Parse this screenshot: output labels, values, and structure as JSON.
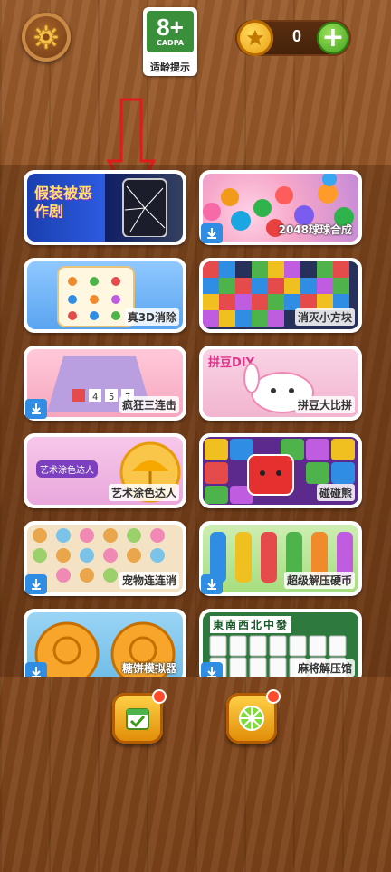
{
  "header": {
    "rating": {
      "age": "8+",
      "org": "CADPA",
      "hint": "适龄提示"
    },
    "coins": {
      "count": "0"
    }
  },
  "games": [
    {
      "label": "",
      "thumb_text": "假装被恶作剧",
      "download": false
    },
    {
      "label": "2048球球合成",
      "download": true
    },
    {
      "label": "真3D消除",
      "download": false
    },
    {
      "label": "消灭小方块",
      "download": false
    },
    {
      "label": "疯狂三连击",
      "download": true
    },
    {
      "label": "拼豆大比拼",
      "thumb_text": "拼豆DIY",
      "download": false
    },
    {
      "label": "艺术涂色达人",
      "thumb_text": "艺术涂色达人",
      "download": false
    },
    {
      "label": "碰碰熊",
      "download": false
    },
    {
      "label": "宠物连连消",
      "download": true
    },
    {
      "label": "超级解压硬币",
      "download": true
    },
    {
      "label": "糖饼模拟器",
      "download": true
    },
    {
      "label": "麻将解压馆",
      "thumb_text": "東南西北中發",
      "download": true
    }
  ],
  "bottom": {
    "daily_badge": true,
    "spin_badge": true
  },
  "colors": {
    "accent_green": "#3a9d1a",
    "download_blue": "#2f8de4",
    "wood": "#8c4f23",
    "arrow_red": "#e11b1b"
  }
}
